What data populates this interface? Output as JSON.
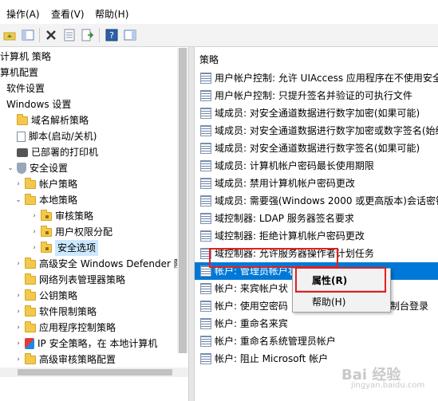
{
  "menu": {
    "action": "操作(A)",
    "view": "查看(V)",
    "help": "帮助(H)"
  },
  "tree": [
    {
      "label": "计算机 策略",
      "indent": 0,
      "chev": "",
      "icon": "none"
    },
    {
      "label": "算机配置",
      "indent": 0,
      "chev": "",
      "icon": "none"
    },
    {
      "label": "软件设置",
      "indent": 1,
      "chev": "",
      "icon": "none"
    },
    {
      "label": "Windows 设置",
      "indent": 1,
      "chev": "",
      "icon": "none"
    },
    {
      "label": "域名解析策略",
      "indent": 2,
      "chev": "",
      "icon": "folder"
    },
    {
      "label": "脚本(启动/关机)",
      "indent": 2,
      "chev": "",
      "icon": "doc"
    },
    {
      "label": "已部署的打印机",
      "indent": 2,
      "chev": "",
      "icon": "printer"
    },
    {
      "label": "安全设置",
      "indent": 2,
      "chev": "expanded",
      "icon": "shield"
    },
    {
      "label": "帐户策略",
      "indent": 3,
      "chev": "collapsed",
      "icon": "folder"
    },
    {
      "label": "本地策略",
      "indent": 3,
      "chev": "expanded",
      "icon": "folder"
    },
    {
      "label": "审核策略",
      "indent": 4,
      "chev": "collapsed",
      "icon": "folder"
    },
    {
      "label": "用户权限分配",
      "indent": 4,
      "chev": "collapsed",
      "icon": "folder"
    },
    {
      "label": "安全选项",
      "indent": 4,
      "chev": "collapsed",
      "icon": "folder",
      "selected": true
    },
    {
      "label": "高级安全 Windows Defender 防",
      "indent": 3,
      "chev": "collapsed",
      "icon": "folder"
    },
    {
      "label": "网络列表管理器策略",
      "indent": 3,
      "chev": "",
      "icon": "folder"
    },
    {
      "label": "公钥策略",
      "indent": 3,
      "chev": "collapsed",
      "icon": "folder"
    },
    {
      "label": "软件限制策略",
      "indent": 3,
      "chev": "collapsed",
      "icon": "folder"
    },
    {
      "label": "应用程序控制策略",
      "indent": 3,
      "chev": "collapsed",
      "icon": "folder"
    },
    {
      "label": "IP 安全策略，在 本地计算机",
      "indent": 3,
      "chev": "collapsed",
      "icon": "ip"
    },
    {
      "label": "高级审核策略配置",
      "indent": 3,
      "chev": "collapsed",
      "icon": "folder"
    }
  ],
  "right_header": "策略",
  "policies": [
    "用户帐户控制: 允许 UIAccess 应用程序在不使用安全",
    "用户帐户控制: 只提升签名并验证的可执行文件",
    "域成员: 对安全通道数据进行数字加密(如果可能)",
    "域成员: 对安全通道数据进行数字加密或数字签名(始终",
    "域成员: 对安全通道数据进行数字签名(如果可能)",
    "域成员: 计算机帐户密码最长使用期限",
    "域成员: 禁用计算机帐户密码更改",
    "域成员: 需要强(Windows 2000 或更高版本)会话密钥",
    "域控制器: LDAP 服务器签名要求",
    "域控制器: 拒绝计算机帐户密码更改",
    "域控制器: 允许服务器操作者计划任务",
    "帐户: 管理员帐户状态",
    "帐户: 来宾帐户状",
    "帐户: 使用空密码",
    "帐户: 重命名来宾",
    "帐户: 重命名系统管理员帐户",
    "帐户: 阻止 Microsoft 帐户"
  ],
  "policy_suffix_right": [
    "",
    "",
    "",
    "",
    "",
    "",
    "",
    "",
    "",
    "",
    "",
    "",
    "",
    "制台登录",
    "",
    "",
    ""
  ],
  "selected_policy_index": 11,
  "context_menu": {
    "properties": "属性(R)",
    "help": "帮助(H)"
  },
  "watermark": "Bai 经验",
  "watermark_sub": "jingyan.baidu.com",
  "colors": {
    "selection": "#0078d7",
    "highlight_box": "#e02020"
  }
}
